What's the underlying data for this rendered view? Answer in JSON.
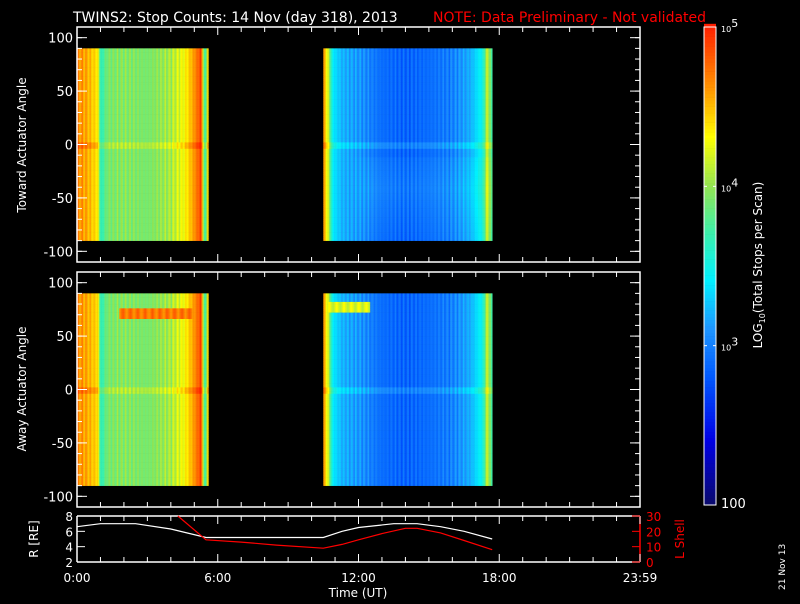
{
  "title": "TWINS2: Stop Counts: 14 Nov (day 318), 2013",
  "note": "NOTE: Data Preliminary - Not validated",
  "date_stamp": "21 Nov 13",
  "colors": {
    "background": "#000000",
    "axes": "#ffffff",
    "note": "#ff0000",
    "r_line": "#ffffff",
    "l_line": "#ff0000"
  },
  "chart_data": [
    {
      "type": "heatmap",
      "name": "toward",
      "ylabel": "Toward Actuator Angle",
      "ylim": [
        -110,
        110
      ],
      "yticks": [
        "100",
        "50",
        "0",
        "-50",
        "-100"
      ],
      "ytick_values": [
        100,
        50,
        0,
        -50,
        -100
      ],
      "xlim": [
        0,
        24
      ],
      "data_angle_range": [
        -90,
        90
      ],
      "segments": [
        {
          "start": 0.0,
          "end": 5.6,
          "profile": [
            [
              0,
              4.65
            ],
            [
              0.4,
              4.55
            ],
            [
              0.9,
              4.35
            ],
            [
              1.0,
              3.6
            ],
            [
              1.3,
              3.9
            ],
            [
              2.0,
              3.95
            ],
            [
              3.0,
              3.9
            ],
            [
              4.0,
              4.05
            ],
            [
              4.6,
              4.3
            ],
            [
              5.0,
              4.6
            ],
            [
              5.3,
              4.9
            ],
            [
              5.45,
              3.5
            ],
            [
              5.6,
              4.6
            ]
          ]
        },
        {
          "start": 10.5,
          "end": 17.7,
          "profile": [
            [
              10.5,
              4.6
            ],
            [
              10.7,
              4.2
            ],
            [
              10.9,
              3.4
            ],
            [
              11.3,
              3.2
            ],
            [
              12.0,
              3.1
            ],
            [
              13.0,
              2.9
            ],
            [
              14.0,
              2.85
            ],
            [
              15.0,
              2.9
            ],
            [
              16.0,
              3.0
            ],
            [
              16.8,
              3.2
            ],
            [
              17.3,
              3.5
            ],
            [
              17.5,
              4.2
            ],
            [
              17.7,
              3.6
            ]
          ]
        }
      ],
      "features": [
        {
          "angle": 0,
          "delta": 0.15
        }
      ]
    },
    {
      "type": "heatmap",
      "name": "away",
      "ylabel": "Away Actuator Angle",
      "ylim": [
        -110,
        110
      ],
      "yticks": [
        "100",
        "50",
        "0",
        "-50",
        "-100"
      ],
      "ytick_values": [
        100,
        50,
        0,
        -50,
        -100
      ],
      "xlim": [
        0,
        24
      ],
      "data_angle_range": [
        -90,
        90
      ],
      "segments": [
        {
          "start": 0.0,
          "end": 5.6,
          "profile": [
            [
              0,
              4.65
            ],
            [
              0.4,
              4.55
            ],
            [
              0.9,
              4.4
            ],
            [
              1.0,
              3.6
            ],
            [
              1.3,
              3.9
            ],
            [
              2.0,
              3.95
            ],
            [
              3.0,
              3.9
            ],
            [
              4.0,
              4.05
            ],
            [
              4.6,
              4.3
            ],
            [
              5.0,
              4.6
            ],
            [
              5.3,
              4.9
            ],
            [
              5.45,
              3.5
            ],
            [
              5.6,
              4.6
            ]
          ]
        },
        {
          "start": 10.5,
          "end": 17.7,
          "profile": [
            [
              10.5,
              4.6
            ],
            [
              10.7,
              4.2
            ],
            [
              10.9,
              3.4
            ],
            [
              11.3,
              3.2
            ],
            [
              12.0,
              3.1
            ],
            [
              13.0,
              2.9
            ],
            [
              14.0,
              2.85
            ],
            [
              15.0,
              2.9
            ],
            [
              16.0,
              3.0
            ],
            [
              16.8,
              3.2
            ],
            [
              17.3,
              3.5
            ],
            [
              17.5,
              4.2
            ],
            [
              17.7,
              3.6
            ]
          ]
        }
      ],
      "features": [
        {
          "angle": 72,
          "width": 10,
          "from": 1.8,
          "to": 5.0,
          "value": 4.7
        },
        {
          "angle": 78,
          "width": 10,
          "from": 10.6,
          "to": 12.5,
          "value": 4.2
        },
        {
          "angle": 0,
          "delta": 0.15
        }
      ]
    },
    {
      "type": "line",
      "name": "orbit",
      "ylabel_left": "R [RE]",
      "ylabel_right": "L Shell",
      "ylim_left": [
        2,
        8
      ],
      "ylim_right": [
        0,
        30
      ],
      "yticks_left": [
        "8",
        "6",
        "4",
        "2"
      ],
      "yticks_right": [
        "30",
        "20",
        "10",
        "0"
      ],
      "xlabel": "Time (UT)",
      "xticks": [
        "0:00",
        "6:00",
        "12:00",
        "18:00",
        "23:59"
      ],
      "xtick_values": [
        0,
        6,
        12,
        18,
        24
      ],
      "series": [
        {
          "name": "R",
          "axis": "left",
          "points": [
            [
              0,
              6.6
            ],
            [
              1,
              7.0
            ],
            [
              2.5,
              7.0
            ],
            [
              4,
              6.3
            ],
            [
              5.5,
              5.2
            ],
            [
              10.5,
              5.2
            ],
            [
              11.3,
              6.0
            ],
            [
              12,
              6.5
            ],
            [
              13.5,
              7.0
            ],
            [
              14.5,
              7.0
            ],
            [
              15.5,
              6.6
            ],
            [
              16.5,
              6.0
            ],
            [
              17.7,
              5.0
            ]
          ]
        },
        {
          "name": "L Shell",
          "axis": "right",
          "points": [
            [
              4.3,
              30
            ],
            [
              5.5,
              14.5
            ],
            [
              7,
              13
            ],
            [
              8.5,
              11
            ],
            [
              10.5,
              9
            ],
            [
              11.3,
              11.5
            ],
            [
              12,
              14.5
            ],
            [
              13,
              18.5
            ],
            [
              14,
              22
            ],
            [
              14.5,
              22
            ],
            [
              15.5,
              19
            ],
            [
              16.5,
              14
            ],
            [
              17.7,
              8
            ]
          ]
        }
      ]
    },
    {
      "type": "colorbar",
      "label": "LOG10(Total Stops per Scan)",
      "label_parts": {
        "pre": "LOG",
        "sub": "10",
        "post": "(Total Stops per Scan)"
      },
      "range_log10": [
        2,
        5
      ],
      "ticks": [
        {
          "base": "10",
          "exp": "5",
          "value": 5
        },
        {
          "base": "10",
          "exp": "4",
          "value": 4
        },
        {
          "base": "10",
          "exp": "3",
          "value": 3
        }
      ],
      "bottom_label": "100"
    }
  ]
}
